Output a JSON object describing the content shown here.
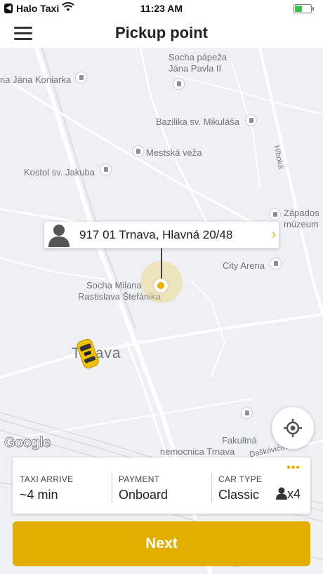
{
  "status_bar": {
    "carrier": "Halo Taxi",
    "time": "11:23 AM",
    "battery_level": 0.5
  },
  "header": {
    "title": "Pickup point",
    "menu_icon": "hamburger-menu-icon"
  },
  "map": {
    "pois": {
      "socha_papeza_1": "Socha pápeža",
      "socha_papeza_2": "Jána Pavla II",
      "riaja_konarka": "ria Jána Koniarka",
      "bazilika": "Bazilika sv. Mikuláša",
      "mestska_veza": "Mestská veža",
      "kostol": "Kostol sv. Jakuba",
      "zapadoslovenske_1": "Západos",
      "zapadoslovenske_2": "múzeum",
      "city_arena": "City Arena",
      "socha_milana_1": "Socha Milana",
      "socha_milana_2": "Rastislava Štefánika",
      "fakultna_1": "Fakultná",
      "fakultna_2": "nemocnica Trnava",
      "hlboka": "Hlboká",
      "city": "Trnava",
      "street_bottom": "Daškóvičova"
    },
    "pickup_address": "917 01 Trnava, Hlavná 20/48",
    "attribution": "Google"
  },
  "ride_info": {
    "taxi_arrive_label": "TAXI ARRIVE",
    "taxi_arrive_value": "~4 min",
    "payment_label": "PAYMENT",
    "payment_value": "Onboard",
    "car_type_label": "CAR TYPE",
    "car_type_value": "Classic",
    "seats": "x4"
  },
  "actions": {
    "next_label": "Next"
  },
  "colors": {
    "accent": "#e2ae00",
    "map_bg": "#eef0f3"
  }
}
